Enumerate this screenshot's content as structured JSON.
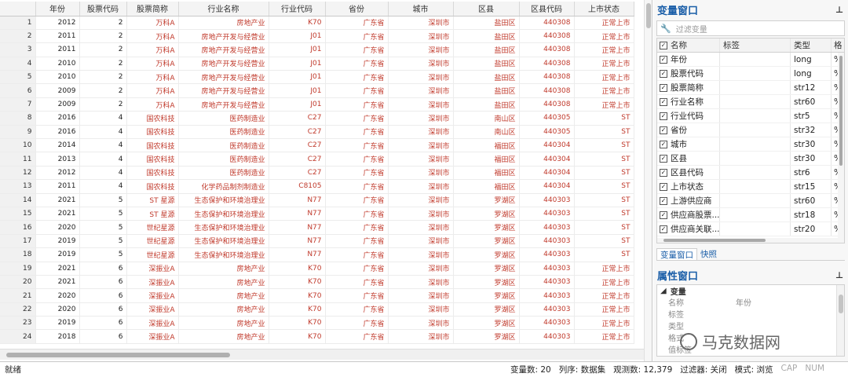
{
  "grid": {
    "columns": [
      "年份",
      "股票代码",
      "股票简称",
      "行业名称",
      "行业代码",
      "省份",
      "城市",
      "区县",
      "区县代码",
      "上市状态"
    ],
    "rows": [
      [
        "1",
        "2012",
        "2",
        "万科A",
        "房地产业",
        "K70",
        "广东省",
        "深圳市",
        "盐田区",
        "440308",
        "正常上市"
      ],
      [
        "2",
        "2011",
        "2",
        "万科A",
        "房地产开发与经营业",
        "J01",
        "广东省",
        "深圳市",
        "盐田区",
        "440308",
        "正常上市"
      ],
      [
        "3",
        "2011",
        "2",
        "万科A",
        "房地产开发与经营业",
        "J01",
        "广东省",
        "深圳市",
        "盐田区",
        "440308",
        "正常上市"
      ],
      [
        "4",
        "2010",
        "2",
        "万科A",
        "房地产开发与经营业",
        "J01",
        "广东省",
        "深圳市",
        "盐田区",
        "440308",
        "正常上市"
      ],
      [
        "5",
        "2010",
        "2",
        "万科A",
        "房地产开发与经营业",
        "J01",
        "广东省",
        "深圳市",
        "盐田区",
        "440308",
        "正常上市"
      ],
      [
        "6",
        "2009",
        "2",
        "万科A",
        "房地产开发与经营业",
        "J01",
        "广东省",
        "深圳市",
        "盐田区",
        "440308",
        "正常上市"
      ],
      [
        "7",
        "2009",
        "2",
        "万科A",
        "房地产开发与经营业",
        "J01",
        "广东省",
        "深圳市",
        "盐田区",
        "440308",
        "正常上市"
      ],
      [
        "8",
        "2016",
        "4",
        "国农科技",
        "医药制造业",
        "C27",
        "广东省",
        "深圳市",
        "南山区",
        "440305",
        "ST"
      ],
      [
        "9",
        "2016",
        "4",
        "国农科技",
        "医药制造业",
        "C27",
        "广东省",
        "深圳市",
        "南山区",
        "440305",
        "ST"
      ],
      [
        "10",
        "2014",
        "4",
        "国农科技",
        "医药制造业",
        "C27",
        "广东省",
        "深圳市",
        "福田区",
        "440304",
        "ST"
      ],
      [
        "11",
        "2013",
        "4",
        "国农科技",
        "医药制造业",
        "C27",
        "广东省",
        "深圳市",
        "福田区",
        "440304",
        "ST"
      ],
      [
        "12",
        "2012",
        "4",
        "国农科技",
        "医药制造业",
        "C27",
        "广东省",
        "深圳市",
        "福田区",
        "440304",
        "ST"
      ],
      [
        "13",
        "2011",
        "4",
        "国农科技",
        "化学药品制剂制造业",
        "C8105",
        "广东省",
        "深圳市",
        "福田区",
        "440304",
        "ST"
      ],
      [
        "14",
        "2021",
        "5",
        "ST 星源",
        "生态保护和环境治理业",
        "N77",
        "广东省",
        "深圳市",
        "罗湖区",
        "440303",
        "ST"
      ],
      [
        "15",
        "2021",
        "5",
        "ST 星源",
        "生态保护和环境治理业",
        "N77",
        "广东省",
        "深圳市",
        "罗湖区",
        "440303",
        "ST"
      ],
      [
        "16",
        "2020",
        "5",
        "世纪星源",
        "生态保护和环境治理业",
        "N77",
        "广东省",
        "深圳市",
        "罗湖区",
        "440303",
        "ST"
      ],
      [
        "17",
        "2019",
        "5",
        "世纪星源",
        "生态保护和环境治理业",
        "N77",
        "广东省",
        "深圳市",
        "罗湖区",
        "440303",
        "ST"
      ],
      [
        "18",
        "2019",
        "5",
        "世纪星源",
        "生态保护和环境治理业",
        "N77",
        "广东省",
        "深圳市",
        "罗湖区",
        "440303",
        "ST"
      ],
      [
        "19",
        "2021",
        "6",
        "深振业A",
        "房地产业",
        "K70",
        "广东省",
        "深圳市",
        "罗湖区",
        "440303",
        "正常上市"
      ],
      [
        "20",
        "2021",
        "6",
        "深振业A",
        "房地产业",
        "K70",
        "广东省",
        "深圳市",
        "罗湖区",
        "440303",
        "正常上市"
      ],
      [
        "21",
        "2020",
        "6",
        "深振业A",
        "房地产业",
        "K70",
        "广东省",
        "深圳市",
        "罗湖区",
        "440303",
        "正常上市"
      ],
      [
        "22",
        "2020",
        "6",
        "深振业A",
        "房地产业",
        "K70",
        "广东省",
        "深圳市",
        "罗湖区",
        "440303",
        "正常上市"
      ],
      [
        "23",
        "2019",
        "6",
        "深振业A",
        "房地产业",
        "K70",
        "广东省",
        "深圳市",
        "罗湖区",
        "440303",
        "正常上市"
      ],
      [
        "24",
        "2018",
        "6",
        "深振业A",
        "房地产业",
        "K70",
        "广东省",
        "深圳市",
        "罗湖区",
        "440303",
        "正常上市"
      ]
    ]
  },
  "variables_panel": {
    "title": "变量窗口",
    "filter_placeholder": "过滤变量",
    "headers": {
      "name": "名称",
      "label": "标签",
      "type": "类型",
      "format": "格"
    },
    "items": [
      {
        "name": "年份",
        "type": "long",
        "format": "%"
      },
      {
        "name": "股票代码",
        "type": "long",
        "format": "%"
      },
      {
        "name": "股票简称",
        "type": "str12",
        "format": "%"
      },
      {
        "name": "行业名称",
        "type": "str60",
        "format": "%"
      },
      {
        "name": "行业代码",
        "type": "str5",
        "format": "%"
      },
      {
        "name": "省份",
        "type": "str32",
        "format": "%"
      },
      {
        "name": "城市",
        "type": "str30",
        "format": "%"
      },
      {
        "name": "区县",
        "type": "str30",
        "format": "%"
      },
      {
        "name": "区县代码",
        "type": "str6",
        "format": "%"
      },
      {
        "name": "上市状态",
        "type": "str15",
        "format": "%"
      },
      {
        "name": "上游供应商",
        "type": "str60",
        "format": "%"
      },
      {
        "name": "供应商股票...",
        "type": "str18",
        "format": "%"
      },
      {
        "name": "供应商关联...",
        "type": "str20",
        "format": "%"
      }
    ],
    "tabs": [
      "变量窗口",
      "快照"
    ]
  },
  "properties_panel": {
    "title": "属性窗口",
    "group": "变量",
    "rows": [
      {
        "key": "名称",
        "value": "年份"
      },
      {
        "key": "标签",
        "value": ""
      },
      {
        "key": "类型",
        "value": ""
      },
      {
        "key": "格式",
        "value": ""
      },
      {
        "key": "值标签",
        "value": ""
      }
    ]
  },
  "status_bar": {
    "left": "就绪",
    "var_count": "变量数: 20",
    "order": "列序: 数据集",
    "obs": "观测数: 12,379",
    "filter": "过滤器: 关闭",
    "mode": "模式: 浏览",
    "cap": "CAP",
    "num": "NUM"
  },
  "watermark": "马克数据网"
}
